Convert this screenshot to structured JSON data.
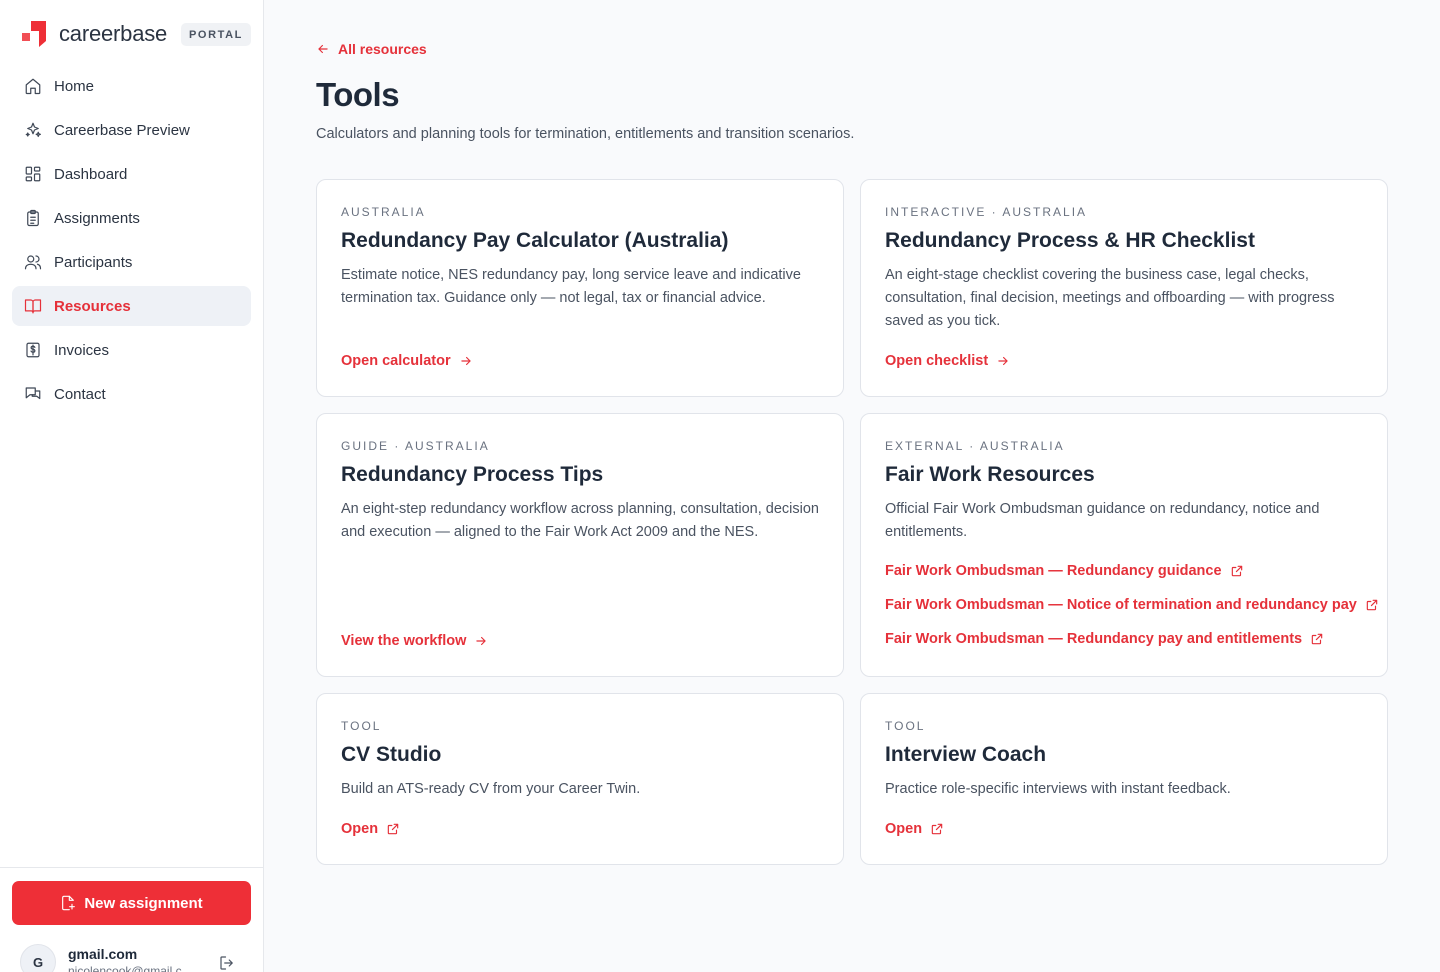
{
  "brand": {
    "name": "careerbase",
    "badge": "PORTAL",
    "accent": "#ee2f37"
  },
  "nav": [
    {
      "label": "Home",
      "icon": "home-icon"
    },
    {
      "label": "Careerbase Preview",
      "icon": "sparkles-icon"
    },
    {
      "label": "Dashboard",
      "icon": "dashboard-icon"
    },
    {
      "label": "Assignments",
      "icon": "clipboard-icon"
    },
    {
      "label": "Participants",
      "icon": "users-icon"
    },
    {
      "label": "Resources",
      "icon": "book-icon",
      "active": true
    },
    {
      "label": "Invoices",
      "icon": "dollar-icon"
    },
    {
      "label": "Contact",
      "icon": "chat-icon"
    }
  ],
  "footer": {
    "new_button": "New assignment",
    "avatar_initial": "G",
    "user_name": "gmail.com",
    "user_email": "nicolencook@gmail.c"
  },
  "main": {
    "back_link": "All resources",
    "title": "Tools",
    "subtitle": "Calculators and planning tools for termination, entitlements and transition scenarios."
  },
  "cards": [
    {
      "eyebrow": "AUSTRALIA",
      "title": "Redundancy Pay Calculator (Australia)",
      "desc": "Estimate notice, NES redundancy pay, long service leave and indicative termination tax. Guidance only — not legal, tax or financial advice.",
      "link": "Open calculator"
    },
    {
      "eyebrow": "INTERACTIVE · AUSTRALIA",
      "title": "Redundancy Process & HR Checklist",
      "desc": "An eight-stage checklist covering the business case, legal checks, consultation, final decision, meetings and offboarding — with progress saved as you tick.",
      "link": "Open checklist"
    },
    {
      "eyebrow": "GUIDE · AUSTRALIA",
      "title": "Redundancy Process Tips",
      "desc": "An eight-step redundancy workflow across planning, consultation, decision and execution — aligned to the Fair Work Act 2009 and the NES.",
      "link": "View the workflow"
    },
    {
      "eyebrow": "EXTERNAL · AUSTRALIA",
      "title": "Fair Work Resources",
      "desc": "Official Fair Work Ombudsman guidance on redundancy, notice and entitlements.",
      "links": [
        "Fair Work Ombudsman — Redundancy guidance",
        "Fair Work Ombudsman — Notice of termination and redundancy pay",
        "Fair Work Ombudsman — Redundancy pay and entitlements"
      ]
    },
    {
      "eyebrow": "TOOL",
      "title": "CV Studio",
      "desc": "Build an ATS-ready CV from your Career Twin.",
      "link": "Open"
    },
    {
      "eyebrow": "TOOL",
      "title": "Interview Coach",
      "desc": "Practice role-specific interviews with instant feedback.",
      "link": "Open"
    }
  ]
}
